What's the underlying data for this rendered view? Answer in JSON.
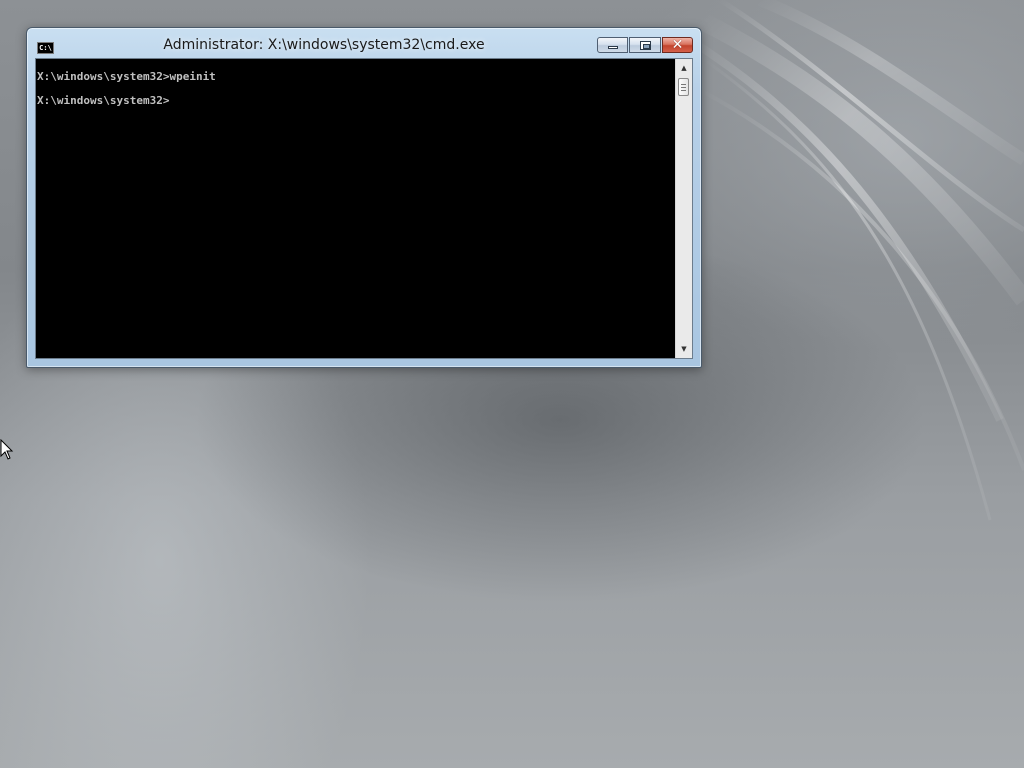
{
  "desktop": {
    "background_color": "#8a8e92"
  },
  "window": {
    "title": "Administrator: X:\\windows\\system32\\cmd.exe",
    "icon_text": "C:\\",
    "icon": "console-app-icon",
    "caption_buttons": {
      "minimize_icon": "minimize-icon",
      "maximize_icon": "maximize-icon",
      "close_icon": "close-icon",
      "close_glyph": "✕"
    },
    "accent_color": "#b7d0e8",
    "close_color": "#c2432c"
  },
  "console": {
    "background": "#000000",
    "foreground": "#c0c0c0",
    "lines": [
      "X:\\windows\\system32>wpeinit",
      "X:\\windows\\system32>"
    ]
  },
  "scrollbar": {
    "up_arrow": "▲",
    "down_arrow": "▼"
  },
  "pointer": {
    "icon": "mouse-pointer-icon"
  }
}
